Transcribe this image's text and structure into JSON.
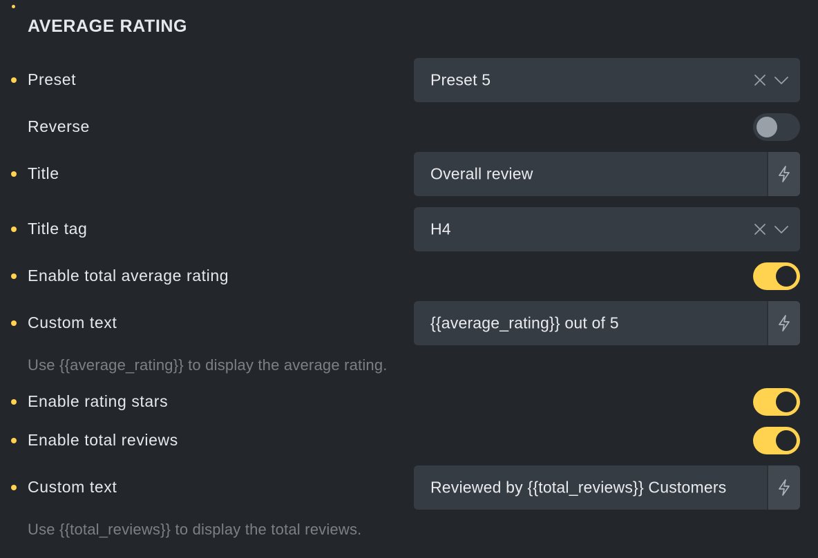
{
  "panel": {
    "section_title": "AVERAGE RATING",
    "rows": {
      "preset": {
        "label": "Preset",
        "value": "Preset 5"
      },
      "reverse": {
        "label": "Reverse",
        "enabled": false
      },
      "title": {
        "label": "Title",
        "value": "Overall review"
      },
      "title_tag": {
        "label": "Title tag",
        "value": "H4"
      },
      "enable_total_average_rating": {
        "label": "Enable total average rating",
        "enabled": true
      },
      "custom_text_1": {
        "label": "Custom text",
        "value": "{{average_rating}} out of 5",
        "hint": "Use {{average_rating}} to display the average rating."
      },
      "enable_rating_stars": {
        "label": "Enable rating stars",
        "enabled": true
      },
      "enable_total_reviews": {
        "label": "Enable total reviews",
        "enabled": true
      },
      "custom_text_2": {
        "label": "Custom text",
        "value": "Reviewed by {{total_reviews}} Customers",
        "hint": "Use {{total_reviews}} to display the total reviews."
      }
    }
  },
  "colors": {
    "background": "#23272c",
    "field": "#363c44",
    "accent": "#ffd24f",
    "hint": "#7b8087"
  },
  "icons": [
    "clear-icon",
    "chevron-down-icon",
    "dynamic-data-icon"
  ]
}
